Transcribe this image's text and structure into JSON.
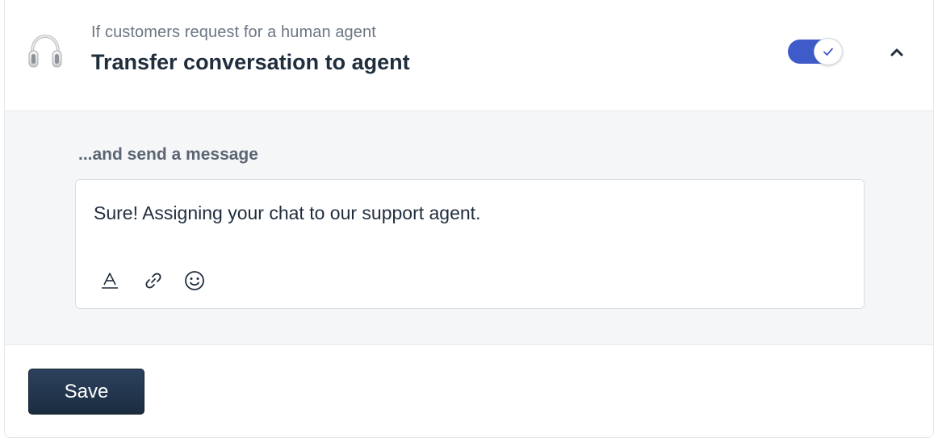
{
  "header": {
    "icon": "headphones-icon",
    "subtitle": "If customers request for a human agent",
    "title": "Transfer conversation to agent",
    "toggle": {
      "state": "on",
      "icon": "check-icon",
      "color": "#3f5bc9"
    },
    "collapse_icon": "chevron-up-icon"
  },
  "message": {
    "label": "...and send a message",
    "text": "Sure! Assigning your chat to our support agent.",
    "toolbar": [
      "text-format-icon",
      "link-icon",
      "emoji-icon"
    ]
  },
  "footer": {
    "save_label": "Save",
    "save_color": "#223650"
  }
}
